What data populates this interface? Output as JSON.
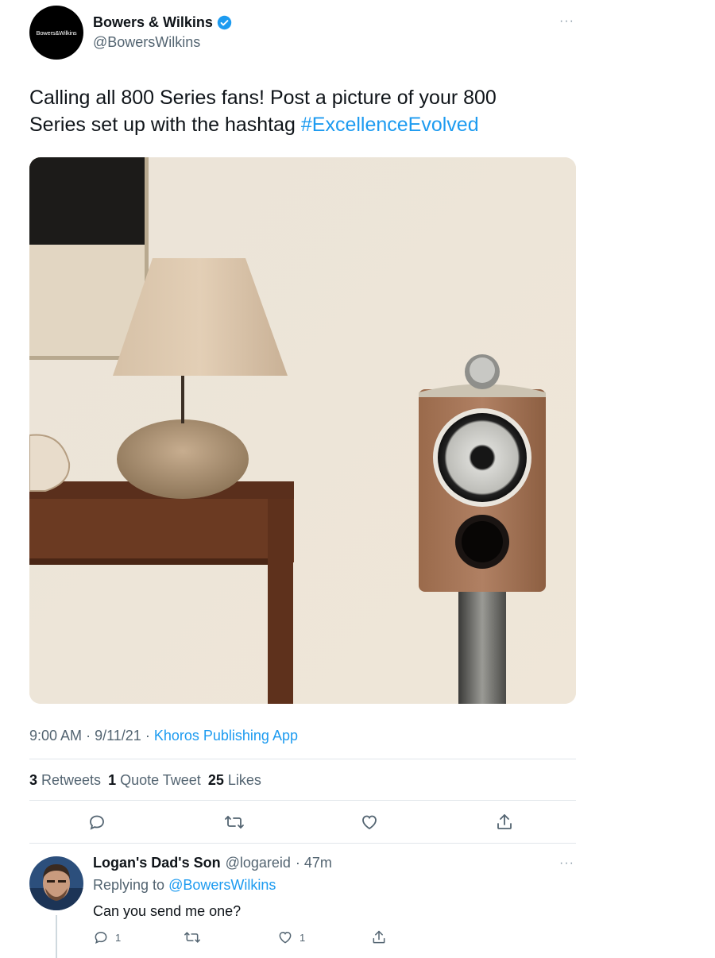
{
  "tweet": {
    "author_name": "Bowers & Wilkins",
    "author_handle": "@BowersWilkins",
    "avatar_logo_text": "Bowers&Wilkins",
    "more": "···",
    "text_before": "Calling all 800 Series fans! Post a picture of your 800 Series set up with the hashtag ",
    "hashtag": "#ExcellenceEvolved",
    "time": "9:00 AM",
    "date": "9/11/21",
    "source": "Khoros Publishing App",
    "separator": "·"
  },
  "stats": {
    "retweets_count": "3",
    "retweets_label": "Retweets",
    "quotes_count": "1",
    "quotes_label": "Quote Tweet",
    "likes_count": "25",
    "likes_label": "Likes"
  },
  "actions": [
    "reply-icon",
    "retweet-icon",
    "like-icon",
    "share-icon"
  ],
  "reply": {
    "name": "Logan's Dad's Son",
    "handle": "@logareid",
    "time": "· 47m",
    "more": "···",
    "replying_prefix": "Replying to",
    "replying_mention": "@BowersWilkins",
    "text": "Can you send me one?",
    "reply_count": "1",
    "like_count": "1"
  },
  "colors": {
    "accent": "#1d9bf0",
    "text": "#0f1419",
    "muted": "#536471",
    "divider": "#e1e6ea"
  }
}
